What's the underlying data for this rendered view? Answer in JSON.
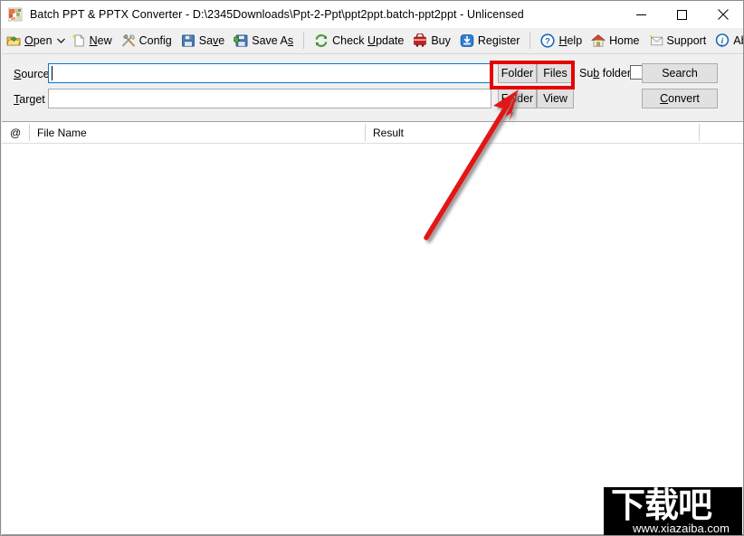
{
  "window": {
    "title": "Batch PPT & PPTX Converter - D:\\2345Downloads\\Ppt-2-Ppt\\ppt2ppt.batch-ppt2ppt - Unlicensed",
    "app_icon": "app-icon",
    "controls": {
      "minimize": "minimize-icon",
      "maximize": "maximize-icon",
      "close": "close-icon"
    }
  },
  "toolbar": {
    "items": [
      {
        "id": "open",
        "label": "Open",
        "accel": "O",
        "icon": "open-folder-icon",
        "dropdown": true
      },
      {
        "id": "new",
        "label": "New",
        "accel": "N",
        "icon": "new-page-icon"
      },
      {
        "id": "config",
        "label": "Config",
        "accel": "",
        "icon": "tools-icon"
      },
      {
        "id": "save",
        "label": "Save",
        "accel": "v",
        "icon": "floppy-icon"
      },
      {
        "id": "save-as",
        "label": "Save As",
        "accel": "s",
        "icon": "floppy-green-icon"
      },
      {
        "id": "check-update",
        "label": "Check Update",
        "accel": "U",
        "icon": "refresh-icon"
      },
      {
        "id": "buy",
        "label": "Buy",
        "accel": "",
        "icon": "cart-icon"
      },
      {
        "id": "register",
        "label": "Register",
        "accel": "",
        "icon": "register-icon"
      },
      {
        "id": "help",
        "label": "Help",
        "accel": "H",
        "icon": "question-icon"
      },
      {
        "id": "home",
        "label": "Home",
        "accel": "",
        "icon": "house-icon"
      },
      {
        "id": "support",
        "label": "Support",
        "accel": "",
        "icon": "envelope-icon"
      },
      {
        "id": "about",
        "label": "About",
        "accel": "",
        "icon": "info-icon"
      }
    ]
  },
  "form": {
    "source": {
      "label": "Source",
      "value": "",
      "placeholder": "",
      "focused": true,
      "folder_button": "Folder",
      "files_button": "Files"
    },
    "target": {
      "label": "Target",
      "value": "",
      "placeholder": "",
      "focused": false,
      "folder_button": "Folder",
      "view_button": "View"
    },
    "sub_folders": {
      "label": "Sub folders",
      "checked": false
    },
    "search_button": "Search",
    "convert_button": "Convert"
  },
  "list": {
    "columns": [
      "@",
      "File Name",
      "Result",
      ""
    ],
    "rows": []
  },
  "annotations": {
    "highlight_rect": "red-rectangle-around-folder-files",
    "arrow": "red-arrow-pointing-to-target-folder-button",
    "color": "#e60000"
  },
  "watermark": {
    "text_cn": "下载吧",
    "url": "www.xiazaiba.com"
  }
}
